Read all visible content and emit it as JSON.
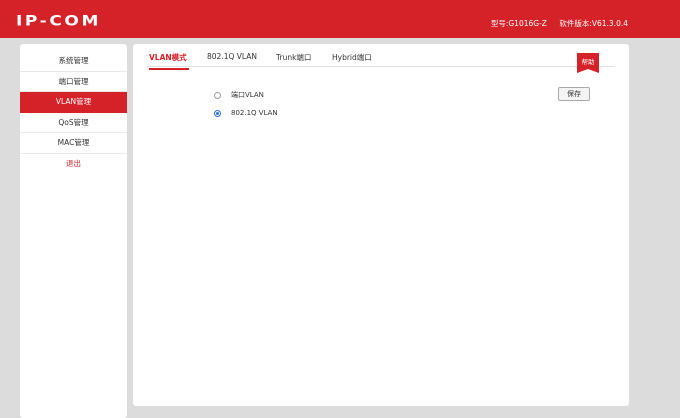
{
  "header": {
    "logo": "IP-COM",
    "model": "型号:G1016G-Z",
    "version": "软件版本:V61.3.0.4"
  },
  "sidebar": {
    "items": [
      {
        "label": "系统管理"
      },
      {
        "label": "端口管理"
      },
      {
        "label": "VLAN管理"
      },
      {
        "label": "QoS管理"
      },
      {
        "label": "MAC管理"
      },
      {
        "label": "退出"
      }
    ],
    "active": "VLAN管理"
  },
  "main": {
    "tabs": [
      {
        "label": "VLAN模式"
      },
      {
        "label": "802.1Q VLAN"
      },
      {
        "label": "Trunk端口"
      },
      {
        "label": "Hybrid端口"
      }
    ],
    "active_tab": "VLAN模式",
    "help_label": "帮助",
    "options": [
      {
        "label": "端口VLAN",
        "checked": false
      },
      {
        "label": "802.1Q VLAN",
        "checked": true
      }
    ],
    "save_label": "保存"
  },
  "colors": {
    "brand": "#d52128",
    "radio_selected": "#2b6fd6",
    "background": "#dcdcdc"
  }
}
